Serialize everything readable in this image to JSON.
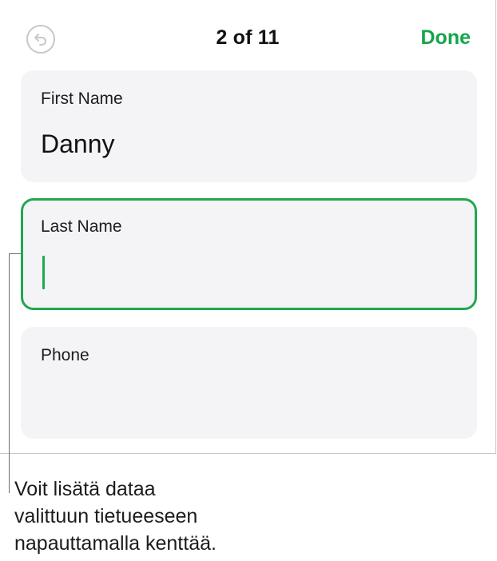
{
  "header": {
    "counter": "2 of 11",
    "done_label": "Done",
    "undo_icon": "undo-arrow-icon"
  },
  "fields": [
    {
      "label": "First Name",
      "value": "Danny"
    },
    {
      "label": "Last Name",
      "value": ""
    },
    {
      "label": "Phone",
      "value": ""
    }
  ],
  "callout": {
    "text": "Voit lisätä dataa\nvalittuun tietueeseen\nnapauttamalla kenttää."
  },
  "colors": {
    "accent": "#20a84f",
    "done": "#13a54a",
    "card": "#f4f4f6"
  }
}
